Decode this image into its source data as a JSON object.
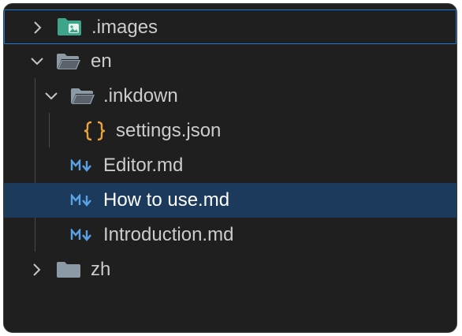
{
  "explorer": {
    "items": [
      {
        "label": ".images",
        "icon": "image-folder-icon",
        "expanded": false
      },
      {
        "label": "en",
        "icon": "folder-open-icon",
        "expanded": true
      },
      {
        "label": ".inkdown",
        "icon": "folder-open-icon",
        "expanded": true
      },
      {
        "label": "settings.json",
        "icon": "json-icon"
      },
      {
        "label": "Editor.md",
        "icon": "markdown-icon"
      },
      {
        "label": "How to use.md",
        "icon": "markdown-icon",
        "selected": true
      },
      {
        "label": "Introduction.md",
        "icon": "markdown-icon"
      },
      {
        "label": "zh",
        "icon": "folder-icon",
        "expanded": false
      }
    ]
  },
  "colors": {
    "background": "#1f1f1f",
    "selected_row": "#1b3a5c",
    "focus_border": "#1f78d1",
    "folder": "#8c9aa6",
    "image_folder": "#3fa58a",
    "json": "#e8a33d",
    "markdown": "#5aa2e6"
  }
}
